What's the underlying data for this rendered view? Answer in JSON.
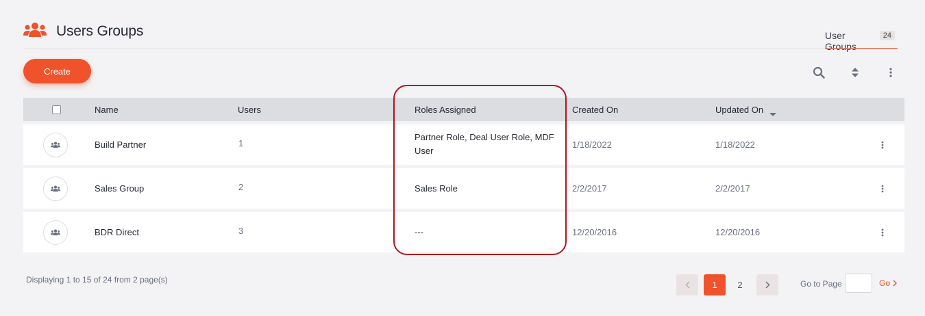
{
  "header": {
    "title": "Users Groups",
    "icon": "users-group-icon",
    "accent_color": "#f0522b"
  },
  "tabs": [
    {
      "label": "User Groups",
      "count": "24",
      "active": true
    }
  ],
  "toolbar": {
    "create_label": "Create",
    "icons": [
      "search-icon",
      "sort-icon",
      "more-vertical-icon"
    ]
  },
  "table": {
    "columns": [
      "Name",
      "Users",
      "Roles Assigned",
      "Created On",
      "Updated On"
    ],
    "sorted_column": "Updated On",
    "rows": [
      {
        "name": "Build Partner",
        "users": "1",
        "roles": "Partner Role, Deal User Role, MDF User",
        "created": "1/18/2022",
        "updated": "1/18/2022"
      },
      {
        "name": "Sales Group",
        "users": "2",
        "roles": "Sales Role",
        "created": "2/2/2017",
        "updated": "2/2/2017"
      },
      {
        "name": "BDR Direct",
        "users": "3",
        "roles": "---",
        "created": "12/20/2016",
        "updated": "12/20/2016"
      }
    ]
  },
  "footer": {
    "info": "Displaying 1 to 15 of 24 from 2 page(s)",
    "pages": [
      "1",
      "2"
    ],
    "current_page": "1",
    "goto_label": "Go to Page",
    "go_label": "Go"
  }
}
